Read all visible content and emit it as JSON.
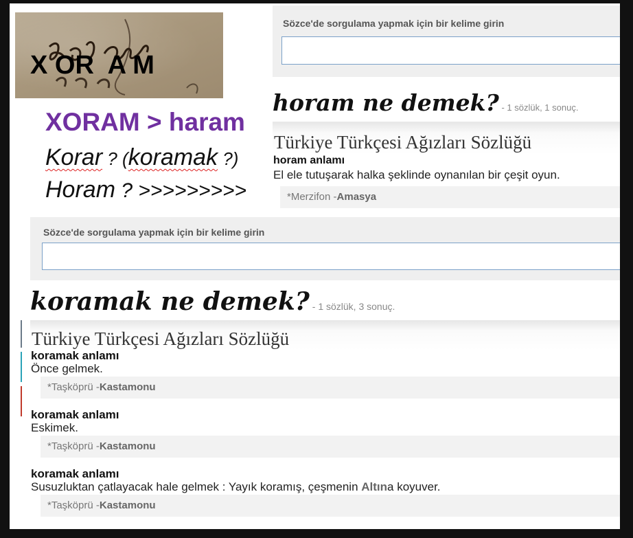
{
  "photo": {
    "caption": "X OR  A M",
    "handwriting_icon": "manuscript-handwriting"
  },
  "annotations": {
    "main": "XORAM > haram",
    "korar_word": "Korar",
    "korar_q": " ? (",
    "koramak_word": "koramak",
    "korar_end": " ?)",
    "horam_word": "Horam",
    "horam_rest": " ? >>>>>>>>>"
  },
  "search": {
    "label": "Sözce'de sorgulama yapmak için bir kelime girin",
    "value": ""
  },
  "horam": {
    "title": "horam ne demek?",
    "subtitle": " - 1 sözlük, 1 sonuç.",
    "dictionary": "Türkiye Türkçesi Ağızları Sözlüğü",
    "entry_head": "horam anlamı",
    "entry_def": "El ele tutuşarak halka şeklinde oynanılan bir çeşit oyun.",
    "source_place": "*Merzifon -",
    "source_city": "Amasya"
  },
  "koramak": {
    "title": "koramak ne demek?",
    "subtitle": " - 1 sözlük, 3 sonuç.",
    "dictionary": "Türkiye Türkçesi Ağızları Sözlüğü",
    "entries": [
      {
        "head": "koramak anlamı",
        "def": "Önce gelmek.",
        "source_place": "*Taşköprü -",
        "source_city": "Kastamonu"
      },
      {
        "head": "koramak anlamı",
        "def": "Eskimek.",
        "source_place": "*Taşköprü -",
        "source_city": "Kastamonu"
      },
      {
        "head": "koramak anlamı",
        "def_pre": "Susuzluktan çatlayacak hale gelmek : Yayık koramış, çeşmenin ",
        "def_hl": "Altın",
        "def_post": "a koyuver.",
        "source_place": "*Taşköprü -",
        "source_city": "Kastamonu"
      }
    ]
  },
  "colors": {
    "annotation_purple": "#7030a0",
    "input_border": "#7aa0c8",
    "frame": "#111111"
  }
}
